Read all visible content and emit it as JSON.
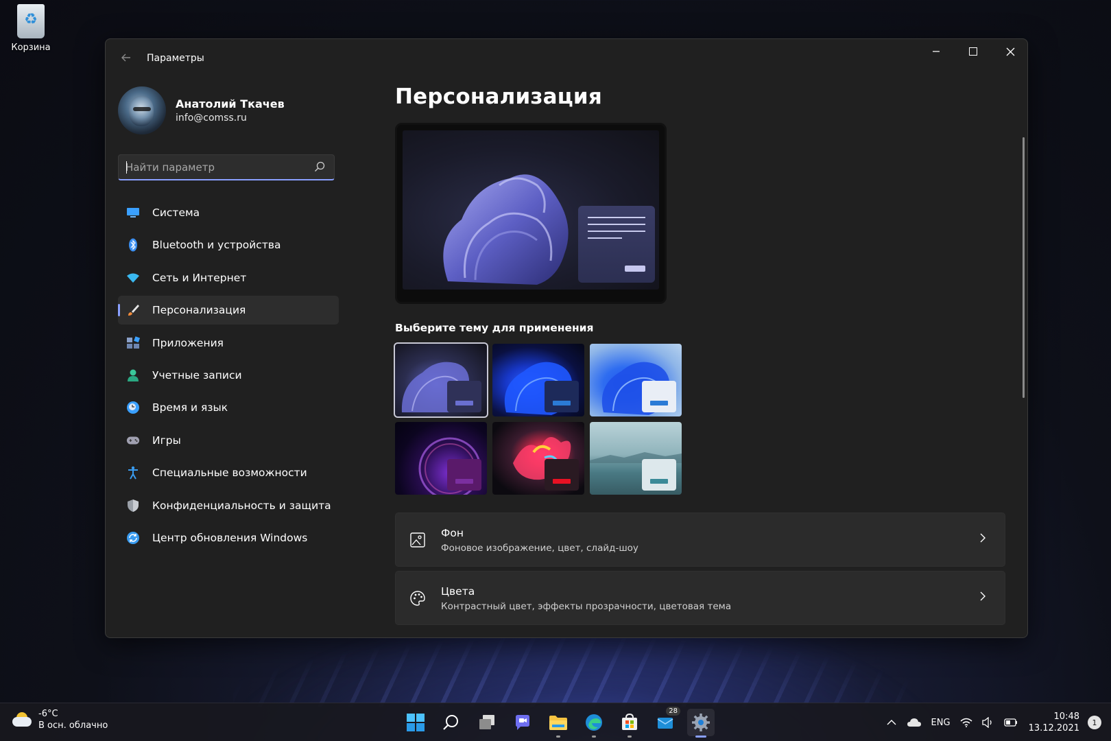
{
  "desktop": {
    "recycle_bin_label": "Корзина"
  },
  "window": {
    "title": "Параметры",
    "controls": {
      "minimize": "—",
      "close": "✕"
    }
  },
  "profile": {
    "name": "Анатолий Ткачев",
    "email": "info@comss.ru"
  },
  "search": {
    "placeholder": "Найти параметр",
    "icon": "search-icon"
  },
  "nav": {
    "items": [
      {
        "label": "Система",
        "icon": "monitor-icon",
        "color": "#3aa0ff"
      },
      {
        "label": "Bluetooth и устройства",
        "icon": "bluetooth-icon",
        "color": "#3a8ef0"
      },
      {
        "label": "Сеть и Интернет",
        "icon": "wifi-icon",
        "color": "#3ab8f0"
      },
      {
        "label": "Персонализация",
        "icon": "brush-icon",
        "color": "#f08a3a",
        "active": true
      },
      {
        "label": "Приложения",
        "icon": "apps-icon",
        "color": "#8aa0c8"
      },
      {
        "label": "Учетные записи",
        "icon": "person-icon",
        "color": "#3ac89a"
      },
      {
        "label": "Время и язык",
        "icon": "clock-globe-icon",
        "color": "#3aa0ff"
      },
      {
        "label": "Игры",
        "icon": "gamepad-icon",
        "color": "#a0a0b0"
      },
      {
        "label": "Специальные возможности",
        "icon": "accessibility-icon",
        "color": "#3a9cf0"
      },
      {
        "label": "Конфиденциальность и защита",
        "icon": "shield-icon",
        "color": "#9aa0a8"
      },
      {
        "label": "Центр обновления Windows",
        "icon": "update-icon",
        "color": "#3a9cf0"
      }
    ]
  },
  "main": {
    "page_title": "Персонализация",
    "themes_title": "Выберите тему для применения",
    "themes": [
      {
        "name": "theme-dark-bloom",
        "selected": true,
        "accent": "#6a6fd0",
        "mini_bg": "#2f3158"
      },
      {
        "name": "theme-windows-dark",
        "selected": false,
        "accent": "#2b7bd6",
        "mini_bg": "#1d2a5a"
      },
      {
        "name": "theme-windows-light",
        "selected": false,
        "accent": "#2b7bd6",
        "mini_bg": "#e9eef6"
      },
      {
        "name": "theme-glow",
        "selected": false,
        "accent": "#7b2fa0",
        "mini_bg": "#5a1a6a"
      },
      {
        "name": "theme-captured-motion",
        "selected": false,
        "accent": "#e81123",
        "mini_bg": "#2a1a22"
      },
      {
        "name": "theme-flow",
        "selected": false,
        "accent": "#3a8a98",
        "mini_bg": "#dde8ec"
      }
    ],
    "cards": [
      {
        "title": "Фон",
        "subtitle": "Фоновое изображение, цвет, слайд-шоу",
        "icon": "image-icon"
      },
      {
        "title": "Цвета",
        "subtitle": "Контрастный цвет, эффекты прозрачности, цветовая тема",
        "icon": "palette-icon"
      }
    ]
  },
  "taskbar": {
    "weather_temp": "-6°C",
    "weather_desc": "В осн. облачно",
    "store_badge": "28",
    "lang": "ENG",
    "time": "10:48",
    "date": "13.12.2021",
    "notifications": "1"
  },
  "colors": {
    "accent": "#8aa0ff",
    "window_bg": "#202020",
    "card_bg": "#2b2b2b"
  }
}
